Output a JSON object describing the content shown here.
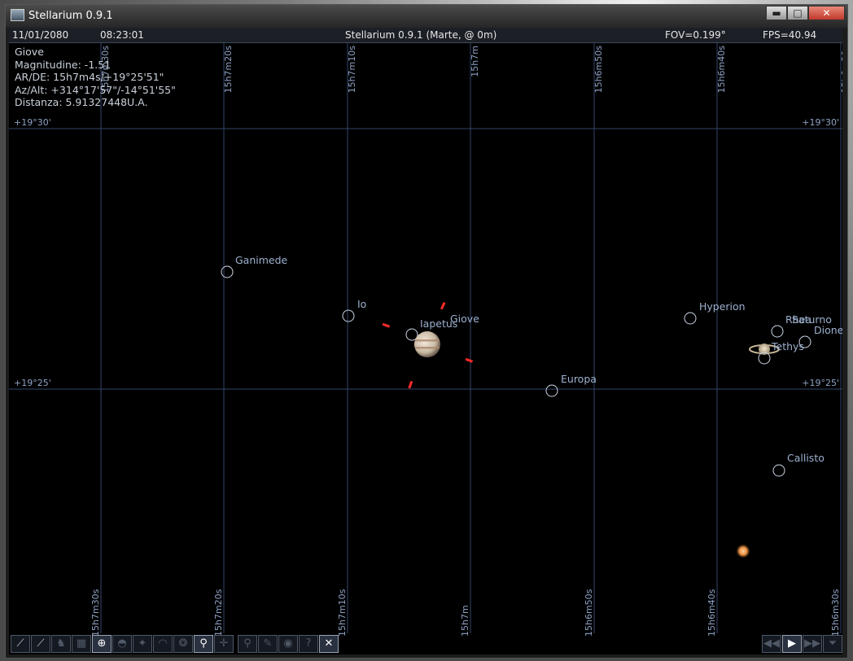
{
  "window": {
    "title": "Stellarium 0.9.1",
    "min_glyph": "▬",
    "max_glyph": "□",
    "close_glyph": "✕"
  },
  "status": {
    "date": "11/01/2080",
    "time": "08:23:01",
    "location": "Stellarium 0.9.1 (Marte,  @ 0m)",
    "fov": "FOV=0.199°",
    "fps": "FPS=40.94"
  },
  "info": {
    "name": "Giove",
    "magnitude": "Magnitudine: -1.51",
    "ra_dec": "AR/DE: 15h7m4s/+19°25'51\"",
    "az_alt": "Az/Alt: +314°17'57\"/-14°51'55\"",
    "distance": "Distanza: 5.91327448U.A."
  },
  "grid": {
    "ra_labels": [
      "15h7m30s",
      "15h7m20s",
      "15h7m10s",
      "15h7m",
      "15h6m50s",
      "15h6m40s",
      "15h6m30s"
    ],
    "dec_labels": [
      "+19°30'",
      "+19°25'"
    ]
  },
  "bodies": {
    "ganimede": "Ganimede",
    "io": "Io",
    "iapetus": "Iapetus",
    "giove": "Giove",
    "europa": "Europa",
    "hyperion": "Hyperion",
    "rhea": "Rhea",
    "saturno": "Saturno",
    "dione": "Dione",
    "tethys": "Tethys",
    "callisto": "Callisto"
  },
  "toolbar": {
    "left": [
      {
        "name": "constellation-lines-icon",
        "glyph": "⟋",
        "active": false
      },
      {
        "name": "constellation-names-icon",
        "glyph": "⟋",
        "active": false
      },
      {
        "name": "constellation-art-icon",
        "glyph": "♞",
        "active": false,
        "dim": true
      },
      {
        "name": "equatorial-grid-icon",
        "glyph": "▦",
        "active": false,
        "dim": true
      },
      {
        "name": "azimuthal-grid-icon",
        "glyph": "⊕",
        "active": true
      },
      {
        "name": "ground-icon",
        "glyph": "◓",
        "active": false,
        "dim": true
      },
      {
        "name": "cardinal-points-icon",
        "glyph": "✦",
        "active": false,
        "dim": true
      },
      {
        "name": "atmosphere-icon",
        "glyph": "◠",
        "active": false,
        "dim": true
      },
      {
        "name": "nebulae-icon",
        "glyph": "❂",
        "active": false,
        "dim": true
      },
      {
        "name": "equatorial-mount-icon",
        "glyph": "⚲",
        "active": true
      },
      {
        "name": "center-selection-icon",
        "glyph": "✛",
        "active": false,
        "dim": true
      },
      {
        "name": "search-icon",
        "glyph": "⚲",
        "active": false,
        "dim": true
      },
      {
        "name": "configuration-icon",
        "glyph": "✎",
        "active": false,
        "dim": true
      },
      {
        "name": "night-mode-icon",
        "glyph": "◉",
        "active": false,
        "dim": true
      },
      {
        "name": "help-icon",
        "glyph": "?",
        "active": false,
        "dim": true
      },
      {
        "name": "quit-icon",
        "glyph": "✕",
        "active": true
      }
    ],
    "right": [
      {
        "name": "rewind-icon",
        "glyph": "◀◀",
        "active": false,
        "dim": true
      },
      {
        "name": "play-icon",
        "glyph": "▶",
        "active": true
      },
      {
        "name": "fast-forward-icon",
        "glyph": "▶▶",
        "active": false,
        "dim": true
      },
      {
        "name": "filter-icon",
        "glyph": "⏷",
        "active": false,
        "dim": true
      }
    ]
  },
  "colors": {
    "grid": "#34466a",
    "label": "#8ea2c4",
    "marker": "#ff2a2a",
    "circle": "#cdd6e8"
  }
}
